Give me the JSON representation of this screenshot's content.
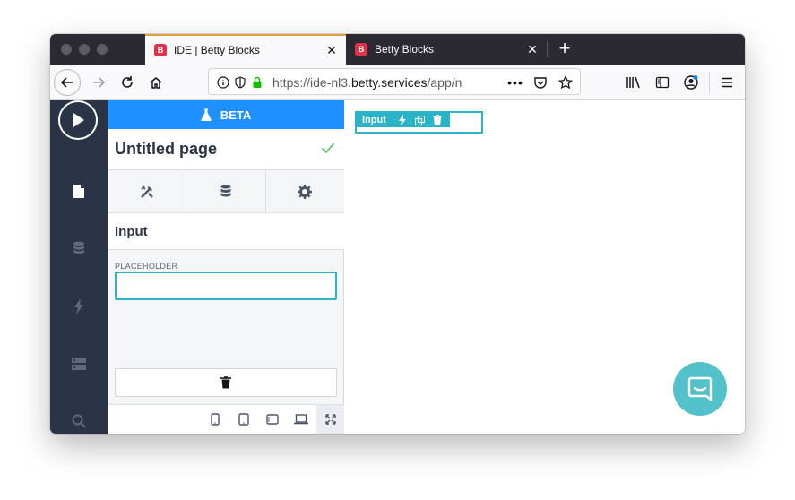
{
  "browser": {
    "tabs": [
      {
        "title": "IDE | Betty Blocks",
        "favicon": "B",
        "active": true
      },
      {
        "title": "Betty Blocks",
        "favicon": "B",
        "active": false
      }
    ],
    "url": {
      "prefix": "https://ide-nl3.",
      "host": "betty.services",
      "path": "/app/n"
    },
    "new_tab_icon": "plus-icon"
  },
  "ide": {
    "beta_label": "BETA",
    "page_title": "Untitled page",
    "component_name": "Input",
    "placeholder_label": "PLACEHOLDER",
    "placeholder_value": "",
    "accent_color": "#1e90ff",
    "teal_color": "#2ab4c7",
    "nav_color": "#2b3346"
  },
  "canvas": {
    "selected_label": "Input"
  }
}
